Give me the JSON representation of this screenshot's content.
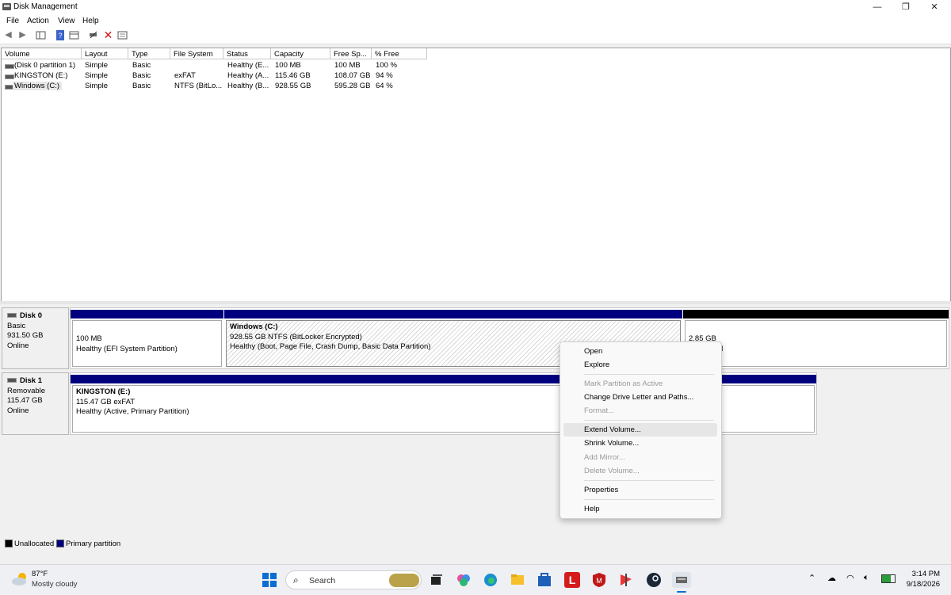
{
  "window": {
    "title": "Disk Management",
    "controls": {
      "minimize": "—",
      "restore": "❐",
      "close": "✕"
    }
  },
  "menu": [
    "File",
    "Action",
    "View",
    "Help"
  ],
  "toolbar": {
    "icons": [
      "back-icon",
      "forward-icon",
      "show-hide-console-tree-icon",
      "help-icon",
      "properties-icon",
      "connect-icon",
      "delete-icon",
      "settings-icon"
    ]
  },
  "volume_list": {
    "columns": [
      "Volume",
      "Layout",
      "Type",
      "File System",
      "Status",
      "Capacity",
      "Free Sp...",
      "% Free"
    ],
    "rows": [
      [
        "(Disk 0 partition 1)",
        "Simple",
        "Basic",
        "",
        "Healthy (E...",
        "100 MB",
        "100 MB",
        "100 %"
      ],
      [
        "KINGSTON (E:)",
        "Simple",
        "Basic",
        "exFAT",
        "Healthy (A...",
        "115.46 GB",
        "108.07 GB",
        "94 %"
      ],
      [
        "Windows (C:)",
        "Simple",
        "Basic",
        "NTFS (BitLo...",
        "Healthy (B...",
        "928.55 GB",
        "595.28 GB",
        "64 %"
      ]
    ]
  },
  "disks": [
    {
      "name": "Disk 0",
      "kind": "Basic",
      "size": "931.50 GB",
      "state": "Online",
      "partitions": [
        {
          "title": "",
          "line1": "100 MB",
          "line2": "Healthy (EFI System Partition)",
          "kind": "primary"
        },
        {
          "title": "Windows  (C:)",
          "line1": "928.55 GB NTFS (BitLocker Encrypted)",
          "line2": "Healthy (Boot, Page File, Crash Dump, Basic Data Partition)",
          "kind": "primary"
        },
        {
          "title": "",
          "line1": "2.85 GB",
          "line2": "d",
          "kind": "unallocated"
        }
      ]
    },
    {
      "name": "Disk 1",
      "kind": "Removable",
      "size": "115.47 GB",
      "state": "Online",
      "partitions": [
        {
          "title": "KINGSTON  (E:)",
          "line1": "115.47 GB exFAT",
          "line2": "Healthy (Active, Primary Partition)",
          "kind": "primary"
        }
      ]
    }
  ],
  "legend": {
    "unallocated": "Unallocated",
    "primary": "Primary partition",
    "unallocated_color": "#000000",
    "primary_color": "#00007f"
  },
  "context_menu": {
    "items": [
      {
        "label": "Open",
        "enabled": true
      },
      {
        "label": "Explore",
        "enabled": true
      },
      {
        "label": "Mark Partition as Active",
        "enabled": false
      },
      {
        "label": "Change Drive Letter and Paths...",
        "enabled": true
      },
      {
        "label": "Format...",
        "enabled": false
      },
      {
        "label": "Extend Volume...",
        "enabled": true,
        "highlighted": true
      },
      {
        "label": "Shrink Volume...",
        "enabled": true
      },
      {
        "label": "Add Mirror...",
        "enabled": false
      },
      {
        "label": "Delete Volume...",
        "enabled": false
      },
      {
        "label": "Properties",
        "enabled": true
      },
      {
        "label": "Help",
        "enabled": true
      }
    ]
  },
  "taskbar": {
    "weather": {
      "temp": "87°F",
      "desc": "Mostly cloudy"
    },
    "search_placeholder": "Search",
    "time": "3:14 PM",
    "date": "9/18/2026"
  }
}
